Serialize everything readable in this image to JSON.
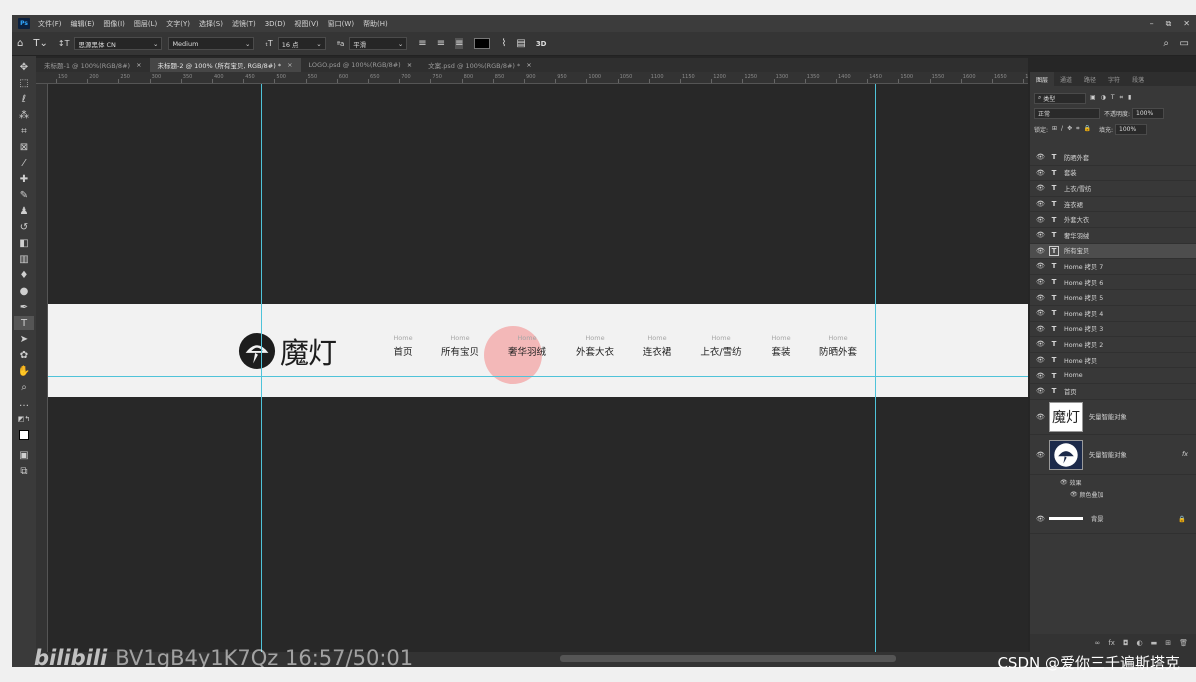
{
  "menubar": {
    "logo": "Ps",
    "items": [
      "文件(F)",
      "编辑(E)",
      "图像(I)",
      "图层(L)",
      "文字(Y)",
      "选择(S)",
      "滤镜(T)",
      "3D(D)",
      "视图(V)",
      "窗口(W)",
      "帮助(H)"
    ],
    "window_controls": [
      "–",
      "⧉",
      "✕"
    ]
  },
  "options_bar": {
    "font_family": "思源黑体 CN",
    "font_style": "Medium",
    "font_size": "16 点",
    "antialias_label": "ªa",
    "antialias": "平滑",
    "threed": "3D",
    "text_color": "#000000"
  },
  "tabs": [
    {
      "label": "未标题-1 @ 100%(RGB/8#)",
      "active": false
    },
    {
      "label": "未标题-2 @ 100% (所有宝贝, RGB/8#) *",
      "active": true
    },
    {
      "label": "LOGO.psd @ 100%(RGB/8#)",
      "active": false
    },
    {
      "label": "文案.psd @ 100%(RGB/8#) *",
      "active": false
    }
  ],
  "ruler": {
    "top_labels": [
      "150",
      "200",
      "250",
      "300",
      "350",
      "400",
      "450",
      "500",
      "550",
      "600",
      "650",
      "700",
      "750",
      "800",
      "850",
      "900",
      "950",
      "1000",
      "1050",
      "1100",
      "1150",
      "1200",
      "1250",
      "1300",
      "1350",
      "1400",
      "1450",
      "1500",
      "1550",
      "1600",
      "1650",
      "1700"
    ]
  },
  "banner": {
    "logo_text": "魔灯",
    "nav": [
      {
        "en": "Home",
        "zh": "首页"
      },
      {
        "en": "Home",
        "zh": "所有宝贝"
      },
      {
        "en": "Home",
        "zh": "奢华羽绒"
      },
      {
        "en": "Home",
        "zh": "外套大衣"
      },
      {
        "en": "Home",
        "zh": "连衣裙"
      },
      {
        "en": "Home",
        "zh": "上衣/雪纺"
      },
      {
        "en": "Home",
        "zh": "套装"
      },
      {
        "en": "Home",
        "zh": "防晒外套"
      }
    ]
  },
  "panel": {
    "tabs": [
      "图层",
      "通道",
      "路径",
      "字符",
      "段落"
    ],
    "filter_kind": "类型",
    "blend_mode": "正常",
    "opacity_label": "不透明度:",
    "opacity": "100%",
    "lock_label": "锁定:",
    "fill_label": "填充:",
    "fill": "100%",
    "layers": [
      {
        "name": "防晒外套",
        "type": "T",
        "selected": false
      },
      {
        "name": "套装",
        "type": "T",
        "selected": false
      },
      {
        "name": "上衣/雪纺",
        "type": "T",
        "selected": false
      },
      {
        "name": "连衣裙",
        "type": "T",
        "selected": false
      },
      {
        "name": "外套大衣",
        "type": "T",
        "selected": false
      },
      {
        "name": "奢华羽绒",
        "type": "T",
        "selected": false
      },
      {
        "name": "所有宝贝",
        "type": "T",
        "selected": true
      },
      {
        "name": "Home 拷贝 7",
        "type": "T",
        "selected": false
      },
      {
        "name": "Home 拷贝 6",
        "type": "T",
        "selected": false
      },
      {
        "name": "Home 拷贝 5",
        "type": "T",
        "selected": false
      },
      {
        "name": "Home 拷贝 4",
        "type": "T",
        "selected": false
      },
      {
        "name": "Home 拷贝 3",
        "type": "T",
        "selected": false
      },
      {
        "name": "Home 拷贝 2",
        "type": "T",
        "selected": false
      },
      {
        "name": "Home 拷贝",
        "type": "T",
        "selected": false
      },
      {
        "name": "Home",
        "type": "T",
        "selected": false
      },
      {
        "name": "首页",
        "type": "T",
        "selected": false
      }
    ],
    "smart_object_1": "矢量智能对象",
    "smart_object_2": "矢量智能对象",
    "effects_label": "效果",
    "effect_color_overlay": "颜色叠加",
    "fx": "fx",
    "background_layer": "背景"
  },
  "watermark": {
    "logo": "bilibili",
    "text": "BV1gB4y1K7Qz 16:57/50:01"
  },
  "csdn_credit": "CSDN @爱你三千遍斯塔克"
}
